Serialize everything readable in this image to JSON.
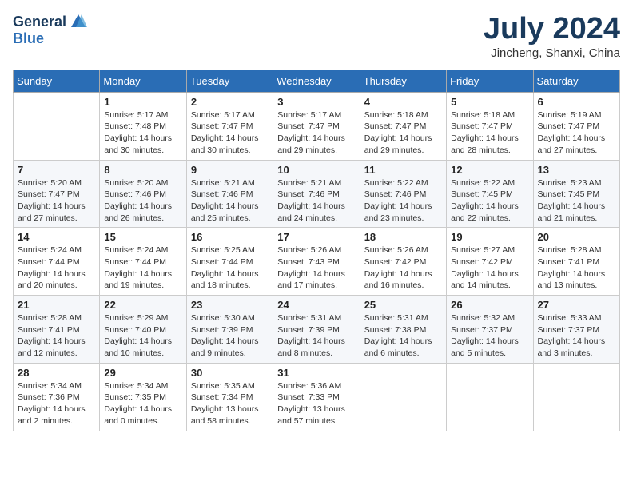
{
  "logo": {
    "general": "General",
    "blue": "Blue"
  },
  "title": "July 2024",
  "location": "Jincheng, Shanxi, China",
  "weekdays": [
    "Sunday",
    "Monday",
    "Tuesday",
    "Wednesday",
    "Thursday",
    "Friday",
    "Saturday"
  ],
  "weeks": [
    [
      {
        "day": "",
        "info": ""
      },
      {
        "day": "1",
        "info": "Sunrise: 5:17 AM\nSunset: 7:48 PM\nDaylight: 14 hours\nand 30 minutes."
      },
      {
        "day": "2",
        "info": "Sunrise: 5:17 AM\nSunset: 7:47 PM\nDaylight: 14 hours\nand 30 minutes."
      },
      {
        "day": "3",
        "info": "Sunrise: 5:17 AM\nSunset: 7:47 PM\nDaylight: 14 hours\nand 29 minutes."
      },
      {
        "day": "4",
        "info": "Sunrise: 5:18 AM\nSunset: 7:47 PM\nDaylight: 14 hours\nand 29 minutes."
      },
      {
        "day": "5",
        "info": "Sunrise: 5:18 AM\nSunset: 7:47 PM\nDaylight: 14 hours\nand 28 minutes."
      },
      {
        "day": "6",
        "info": "Sunrise: 5:19 AM\nSunset: 7:47 PM\nDaylight: 14 hours\nand 27 minutes."
      }
    ],
    [
      {
        "day": "7",
        "info": "Sunrise: 5:20 AM\nSunset: 7:47 PM\nDaylight: 14 hours\nand 27 minutes."
      },
      {
        "day": "8",
        "info": "Sunrise: 5:20 AM\nSunset: 7:46 PM\nDaylight: 14 hours\nand 26 minutes."
      },
      {
        "day": "9",
        "info": "Sunrise: 5:21 AM\nSunset: 7:46 PM\nDaylight: 14 hours\nand 25 minutes."
      },
      {
        "day": "10",
        "info": "Sunrise: 5:21 AM\nSunset: 7:46 PM\nDaylight: 14 hours\nand 24 minutes."
      },
      {
        "day": "11",
        "info": "Sunrise: 5:22 AM\nSunset: 7:46 PM\nDaylight: 14 hours\nand 23 minutes."
      },
      {
        "day": "12",
        "info": "Sunrise: 5:22 AM\nSunset: 7:45 PM\nDaylight: 14 hours\nand 22 minutes."
      },
      {
        "day": "13",
        "info": "Sunrise: 5:23 AM\nSunset: 7:45 PM\nDaylight: 14 hours\nand 21 minutes."
      }
    ],
    [
      {
        "day": "14",
        "info": "Sunrise: 5:24 AM\nSunset: 7:44 PM\nDaylight: 14 hours\nand 20 minutes."
      },
      {
        "day": "15",
        "info": "Sunrise: 5:24 AM\nSunset: 7:44 PM\nDaylight: 14 hours\nand 19 minutes."
      },
      {
        "day": "16",
        "info": "Sunrise: 5:25 AM\nSunset: 7:44 PM\nDaylight: 14 hours\nand 18 minutes."
      },
      {
        "day": "17",
        "info": "Sunrise: 5:26 AM\nSunset: 7:43 PM\nDaylight: 14 hours\nand 17 minutes."
      },
      {
        "day": "18",
        "info": "Sunrise: 5:26 AM\nSunset: 7:42 PM\nDaylight: 14 hours\nand 16 minutes."
      },
      {
        "day": "19",
        "info": "Sunrise: 5:27 AM\nSunset: 7:42 PM\nDaylight: 14 hours\nand 14 minutes."
      },
      {
        "day": "20",
        "info": "Sunrise: 5:28 AM\nSunset: 7:41 PM\nDaylight: 14 hours\nand 13 minutes."
      }
    ],
    [
      {
        "day": "21",
        "info": "Sunrise: 5:28 AM\nSunset: 7:41 PM\nDaylight: 14 hours\nand 12 minutes."
      },
      {
        "day": "22",
        "info": "Sunrise: 5:29 AM\nSunset: 7:40 PM\nDaylight: 14 hours\nand 10 minutes."
      },
      {
        "day": "23",
        "info": "Sunrise: 5:30 AM\nSunset: 7:39 PM\nDaylight: 14 hours\nand 9 minutes."
      },
      {
        "day": "24",
        "info": "Sunrise: 5:31 AM\nSunset: 7:39 PM\nDaylight: 14 hours\nand 8 minutes."
      },
      {
        "day": "25",
        "info": "Sunrise: 5:31 AM\nSunset: 7:38 PM\nDaylight: 14 hours\nand 6 minutes."
      },
      {
        "day": "26",
        "info": "Sunrise: 5:32 AM\nSunset: 7:37 PM\nDaylight: 14 hours\nand 5 minutes."
      },
      {
        "day": "27",
        "info": "Sunrise: 5:33 AM\nSunset: 7:37 PM\nDaylight: 14 hours\nand 3 minutes."
      }
    ],
    [
      {
        "day": "28",
        "info": "Sunrise: 5:34 AM\nSunset: 7:36 PM\nDaylight: 14 hours\nand 2 minutes."
      },
      {
        "day": "29",
        "info": "Sunrise: 5:34 AM\nSunset: 7:35 PM\nDaylight: 14 hours\nand 0 minutes."
      },
      {
        "day": "30",
        "info": "Sunrise: 5:35 AM\nSunset: 7:34 PM\nDaylight: 13 hours\nand 58 minutes."
      },
      {
        "day": "31",
        "info": "Sunrise: 5:36 AM\nSunset: 7:33 PM\nDaylight: 13 hours\nand 57 minutes."
      },
      {
        "day": "",
        "info": ""
      },
      {
        "day": "",
        "info": ""
      },
      {
        "day": "",
        "info": ""
      }
    ]
  ]
}
